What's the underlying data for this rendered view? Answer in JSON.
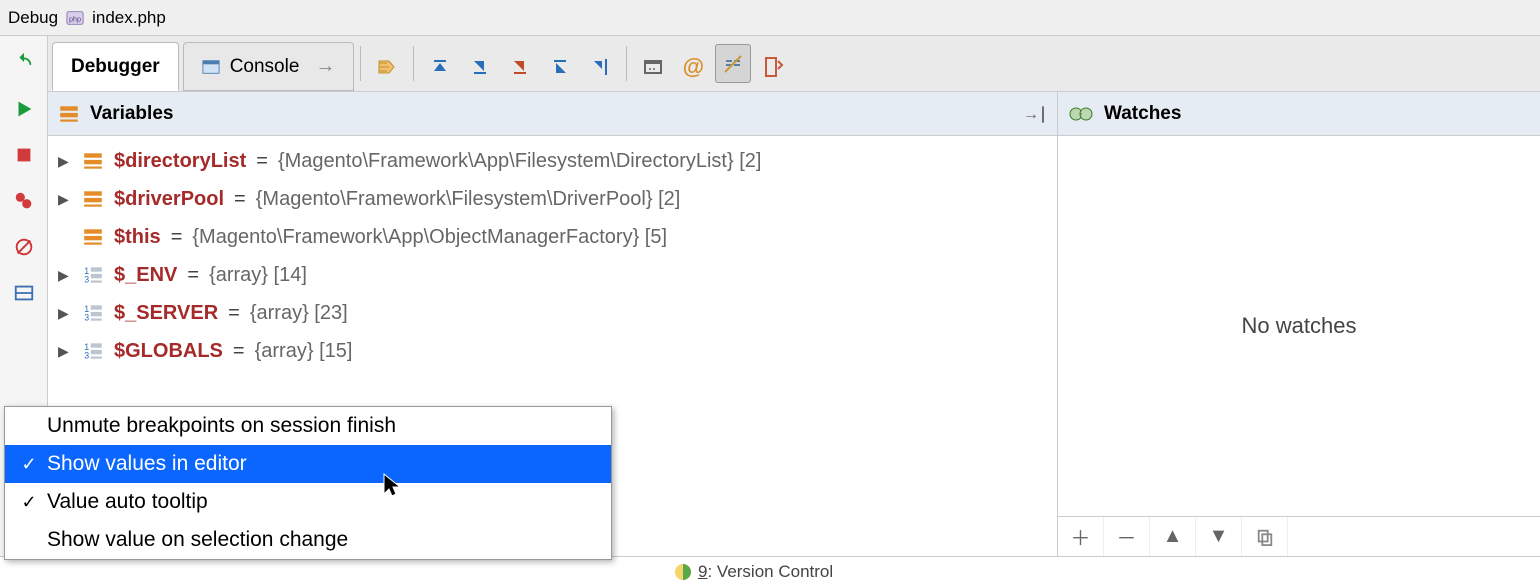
{
  "breadcrumb": {
    "label": "Debug",
    "file": "index.php"
  },
  "tabs": {
    "debugger": "Debugger",
    "console": "Console"
  },
  "panels": {
    "variables_title": "Variables",
    "watches_title": "Watches",
    "no_watches": "No watches"
  },
  "variables": [
    {
      "name": "$directoryList",
      "value": "{Magento\\Framework\\App\\Filesystem\\DirectoryList} [2]",
      "icon": "obj",
      "expandable": true
    },
    {
      "name": "$driverPool",
      "value": "{Magento\\Framework\\Filesystem\\DriverPool} [2]",
      "icon": "obj",
      "expandable": true
    },
    {
      "name": "$this",
      "value": "{Magento\\Framework\\App\\ObjectManagerFactory} [5]",
      "icon": "obj",
      "expandable": false
    },
    {
      "name": "$_ENV",
      "value": "{array} [14]",
      "icon": "arr",
      "expandable": true
    },
    {
      "name": "$_SERVER",
      "value": "{array} [23]",
      "icon": "arr",
      "expandable": true
    },
    {
      "name": "$GLOBALS",
      "value": "{array} [15]",
      "icon": "arr",
      "expandable": true
    }
  ],
  "context_menu": {
    "items": [
      {
        "label": "Unmute breakpoints on session finish",
        "checked": false,
        "selected": false
      },
      {
        "label": "Show values in editor",
        "checked": true,
        "selected": true
      },
      {
        "label": "Value auto tooltip",
        "checked": true,
        "selected": false
      },
      {
        "label": "Show value on selection change",
        "checked": false,
        "selected": false
      }
    ]
  },
  "statusbar": {
    "vc_prefix": "9",
    "vc_label": ": Version Control"
  }
}
